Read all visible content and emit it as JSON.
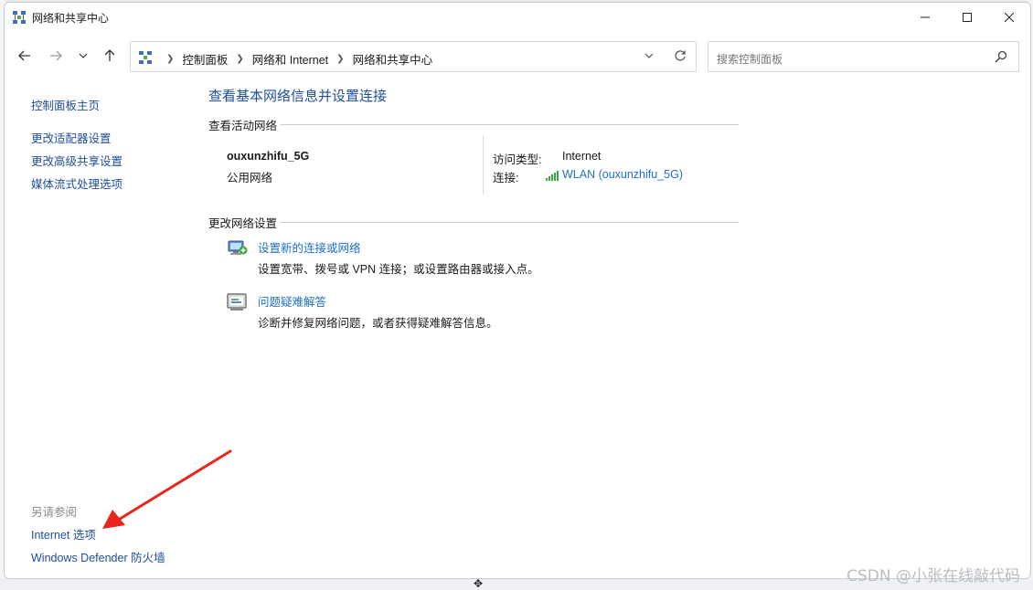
{
  "window": {
    "title": "网络和共享中心"
  },
  "navigation": {
    "breadcrumbs": [
      "控制面板",
      "网络和 Internet",
      "网络和共享中心"
    ],
    "search_placeholder": "搜索控制面板"
  },
  "sidebar": {
    "items": [
      {
        "label": "控制面板主页"
      },
      {
        "label": "更改适配器设置"
      },
      {
        "label": "更改高级共享设置"
      },
      {
        "label": "媒体流式处理选项"
      }
    ],
    "see_also_title": "另请参阅",
    "see_also": [
      {
        "label": "Internet 选项"
      },
      {
        "label": "Windows Defender 防火墙"
      }
    ]
  },
  "main": {
    "title": "查看基本网络信息并设置连接",
    "active_networks_heading": "查看活动网络",
    "network": {
      "name": "ouxunzhifu_5G",
      "profile": "公用网络",
      "access_type_label": "访问类型:",
      "access_type_value": "Internet",
      "connection_label": "连接:",
      "connection_value": "WLAN (ouxunzhifu_5G)"
    },
    "change_settings_heading": "更改网络设置",
    "tasks": [
      {
        "label": "设置新的连接或网络",
        "description": "设置宽带、拨号或 VPN 连接；或设置路由器或接入点。",
        "icon": "new-connection-icon"
      },
      {
        "label": "问题疑难解答",
        "description": "诊断并修复网络问题，或者获得疑难解答信息。",
        "icon": "troubleshoot-icon"
      }
    ]
  },
  "overlay": {
    "watermark": "CSDN @小张在线敲代码",
    "arrow_color": "#e8261c"
  },
  "colors": {
    "link": "#1e4e9c",
    "accent_link": "#1e6fc5",
    "signal": "#3aa83a"
  }
}
